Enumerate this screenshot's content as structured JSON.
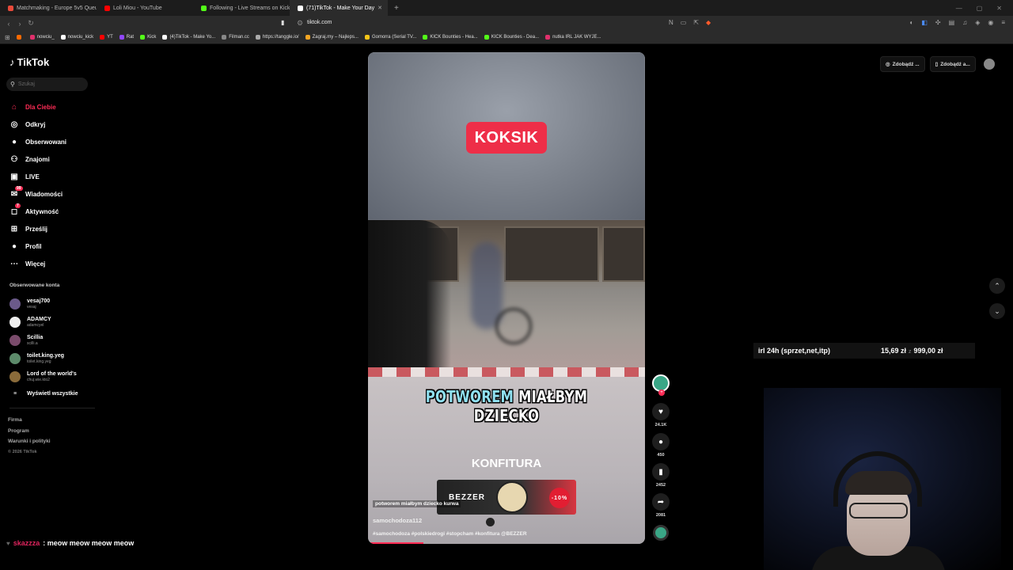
{
  "browser": {
    "tabs": [
      {
        "title": "Matchmaking - Europe 5v5 Queue",
        "color": "#e84a3a",
        "active": false
      },
      {
        "title": "Loli Miou - YouTube",
        "color": "#ff0000",
        "active": false
      },
      {
        "title": "Following - Live Streams on Kick",
        "color": "#53fc18",
        "active": false
      },
      {
        "title": "(71)TikTok - Make Your Day",
        "color": "#ffffff",
        "active": true
      }
    ],
    "url": "tiktok.com",
    "bookmarks": [
      {
        "label": "",
        "color": "#ff6a00"
      },
      {
        "label": "nowciu_",
        "color": "#e1306c"
      },
      {
        "label": "nowciu_kick",
        "color": "#ffffff"
      },
      {
        "label": "YT",
        "color": "#ff0000"
      },
      {
        "label": "Rat",
        "color": "#9146ff"
      },
      {
        "label": "Kick",
        "color": "#53fc18"
      },
      {
        "label": "(4)TikTok - Make Yo...",
        "color": "#ffffff"
      },
      {
        "label": "Filman.cc",
        "color": "#888888"
      },
      {
        "label": "https://tanggle.io/",
        "color": "#aaaaaa"
      },
      {
        "label": "Zagraj.my – Najleps...",
        "color": "#f5a623"
      },
      {
        "label": "Gomorra (Serial TV...",
        "color": "#f5c518"
      },
      {
        "label": "KICK Bounties - Hea...",
        "color": "#53fc18"
      },
      {
        "label": "KICK Bounties - Dea...",
        "color": "#53fc18"
      },
      {
        "label": "nutka IRL JAK WYJE...",
        "color": "#e1306c"
      }
    ]
  },
  "tiktok": {
    "logo": "TikTok",
    "search_placeholder": "Szukaj",
    "menu": [
      {
        "label": "Dla Ciebie",
        "icon": "home-icon",
        "glyph": "⌂",
        "active": true
      },
      {
        "label": "Odkryj",
        "icon": "compass-icon",
        "glyph": "◎"
      },
      {
        "label": "Obserwowani",
        "icon": "following-avatar-icon",
        "glyph": "●"
      },
      {
        "label": "Znajomi",
        "icon": "friends-icon",
        "glyph": "⚇"
      },
      {
        "label": "LIVE",
        "icon": "live-icon",
        "glyph": "▣"
      },
      {
        "label": "Wiadomości",
        "icon": "messages-icon",
        "glyph": "✉",
        "badge": "99"
      },
      {
        "label": "Aktywność",
        "icon": "activity-icon",
        "glyph": "◻",
        "badge": "7"
      },
      {
        "label": "Prześlij",
        "icon": "upload-icon",
        "glyph": "⊞"
      },
      {
        "label": "Profil",
        "icon": "profile-icon",
        "glyph": "●"
      },
      {
        "label": "Więcej",
        "icon": "more-icon",
        "glyph": "⋯"
      }
    ],
    "following_title": "Obserwowane konta",
    "following": [
      {
        "name": "vesaj700",
        "handle": "vesaj",
        "color": "#6b5a8a"
      },
      {
        "name": "ADAMCY",
        "handle": "adamcyel",
        "color": "#eeeeee"
      },
      {
        "name": "Scillia",
        "handle": "scilli.a",
        "color": "#7a4b6b"
      },
      {
        "name": "toilet.king.yeg",
        "handle": "toilet.king.yeg",
        "color": "#5c8a6a"
      },
      {
        "name": "Lord of the world's",
        "handle": "chuj.wie.kto2",
        "color": "#8a6b3a"
      }
    ],
    "show_all": "Wyświetl wszystkie",
    "footer": [
      "Firma",
      "Program",
      "Warunki i polityki"
    ],
    "copyright": "© 2026 TikTok",
    "topright": [
      "Zdobądź ...",
      "Zdobądź a..."
    ]
  },
  "video": {
    "top_label": "KOKSIK",
    "caption_highlight": "POTWOREM",
    "caption_rest": " MIAŁBYM DZIECKO",
    "caption2": "KONFITURA",
    "ad_brand": "BEZZER",
    "ad_discount": "-10%",
    "sticker": "potworem miałbym dziecko kurwa",
    "author": "samochodoza112",
    "tags": "#samochodoza #polskiedrogi #stopcham #konfitura @BEZZER",
    "progress": 0.2,
    "likes": "24.1K",
    "comments": "450",
    "saves": "2452",
    "shares": "2081"
  },
  "stream": {
    "goal_label": "irl 24h (sprzet,net,itp)",
    "goal_current": "15,69 zł",
    "goal_sep": "z",
    "goal_target": "999,00 zł",
    "chat_user": "skazzza",
    "chat_message": ": meow meow meow meow"
  }
}
